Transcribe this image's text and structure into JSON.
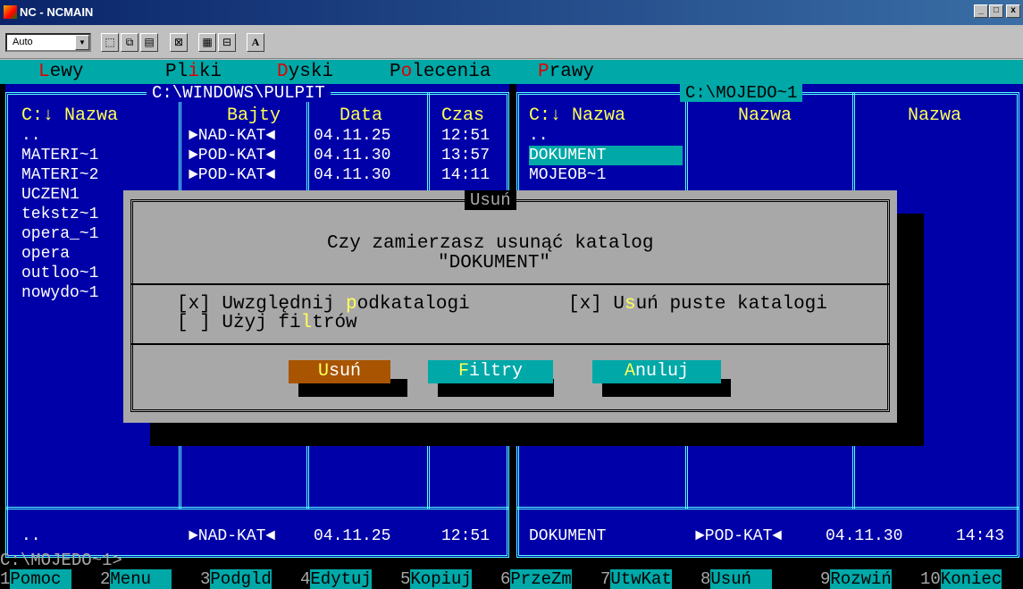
{
  "window": {
    "title": "NC - NCMAIN",
    "controls": [
      "_",
      "□",
      "x"
    ]
  },
  "toolbar": {
    "font_select": "Auto",
    "letter_button": "A"
  },
  "menubar": {
    "items": [
      {
        "label": "Lewy",
        "hot": "L"
      },
      {
        "label": "Pliki",
        "hot": "i"
      },
      {
        "label": "Dyski",
        "hot": "D"
      },
      {
        "label": "Polecenia",
        "hot": "o"
      },
      {
        "label": "Prawy",
        "hot": "P"
      }
    ]
  },
  "left_panel": {
    "path": "C:\\WINDOWS\\PULPIT",
    "headers": [
      "C:↓ Nazwa",
      "Bajty",
      "Data",
      "Czas"
    ],
    "rows": [
      {
        "name": "..",
        "size": "►NAD-KAT◄",
        "date": "04.11.25",
        "time": "12:51"
      },
      {
        "name": "MATERI~1",
        "size": "►POD-KAT◄",
        "date": "04.11.30",
        "time": "13:57"
      },
      {
        "name": "MATERI~2",
        "size": "►POD-KAT◄",
        "date": "04.11.30",
        "time": "14:11"
      },
      {
        "name": "UCZEN1"
      },
      {
        "name": "tekstz~1"
      },
      {
        "name": "opera_~1"
      },
      {
        "name": "opera"
      },
      {
        "name": "outloo~1"
      },
      {
        "name": "nowydo~1"
      }
    ],
    "status": {
      "name": "..",
      "size": "►NAD-KAT◄",
      "date": "04.11.25",
      "time": "12:51"
    }
  },
  "right_panel": {
    "path": "C:\\MOJEDO~1",
    "headers": [
      "C:↓ Nazwa",
      "Nazwa",
      "Nazwa"
    ],
    "rows": [
      {
        "name": ".."
      },
      {
        "name": "DOKUMENT",
        "selected": true
      },
      {
        "name": "MOJEOB~1"
      }
    ],
    "status": {
      "name": "DOKUMENT",
      "size": "►POD-KAT◄",
      "date": "04.11.30",
      "time": "14:43"
    }
  },
  "dialog": {
    "title": "Usuń",
    "question": "Czy zamierzasz usunąć katalog",
    "target": "\"DOKUMENT\"",
    "options": [
      {
        "check": "[x]",
        "pre": "Uwzględnij ",
        "hot": "p",
        "post": "odkatalogi"
      },
      {
        "check": "[x]",
        "pre": "U",
        "hot": "s",
        "post": "uń puste katalogi"
      },
      {
        "check": "[ ]",
        "pre": "Użyj fi",
        "hot": "l",
        "post": "trów"
      }
    ],
    "buttons": [
      {
        "pre": "",
        "hot": "U",
        "post": "suń"
      },
      {
        "pre": "",
        "hot": "F",
        "post": "iltry"
      },
      {
        "pre": "",
        "hot": "A",
        "post": "nuluj"
      }
    ]
  },
  "command_line": "C:\\MOJEDO~1>",
  "fkeys": [
    {
      "n": "1",
      "label": "Pomoc "
    },
    {
      "n": "2",
      "label": "Menu  "
    },
    {
      "n": "3",
      "label": "Podgld"
    },
    {
      "n": "4",
      "label": "Edytuj"
    },
    {
      "n": "5",
      "label": "Kopiuj"
    },
    {
      "n": "6",
      "label": "PrzeZm"
    },
    {
      "n": "7",
      "label": "UtwKat"
    },
    {
      "n": "8",
      "label": "Usuń  "
    },
    {
      "n": "9",
      "label": "Rozwiń"
    },
    {
      "n": "10",
      "label": "Koniec"
    }
  ],
  "colors": {
    "panel_bg": "#0000a8",
    "cyan": "#55ffff",
    "menubar": "#00a8a8",
    "dialog_bg": "#a8a8a8",
    "hotkey": "#ffff55",
    "usun_button": "#a85400",
    "teal_button": "#00a8a8"
  }
}
